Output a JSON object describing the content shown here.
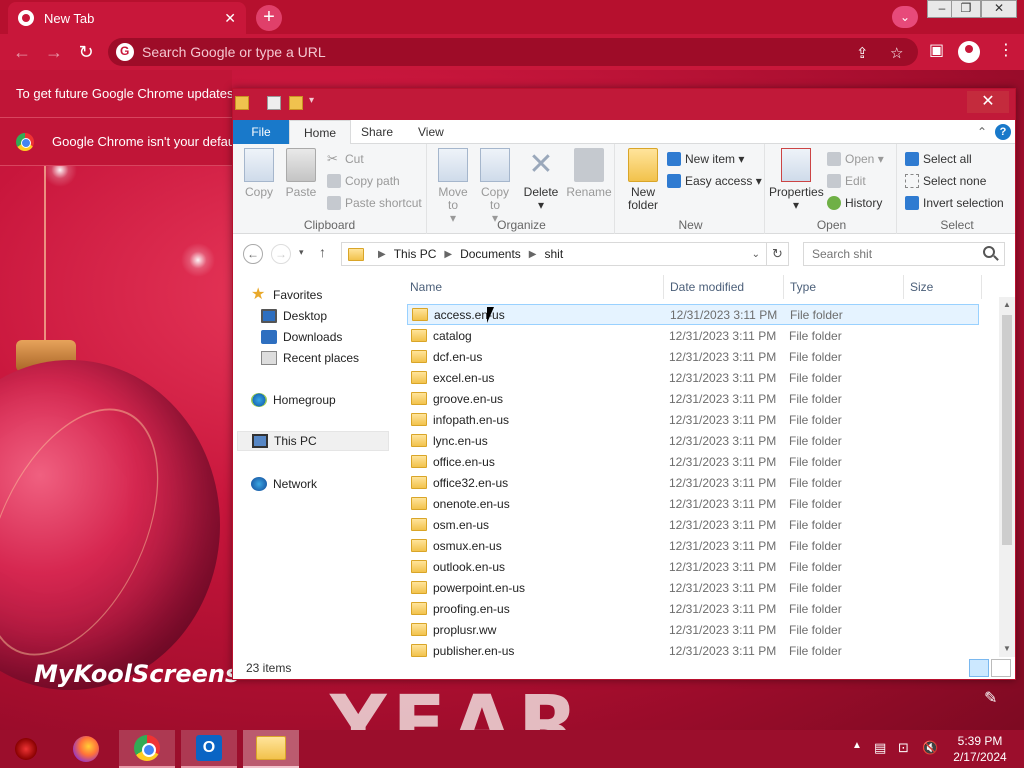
{
  "chrome": {
    "tab_title": "New Tab",
    "new_tab_symbol": "+",
    "omnibox_placeholder": "Search Google or type a URL",
    "infobar_update": "To get future Google Chrome updates",
    "infobar_default": "Google Chrome isn't your default browser"
  },
  "explorer": {
    "ribbon_tabs": [
      "File",
      "Home",
      "Share",
      "View"
    ],
    "clipboard": {
      "label": "Clipboard",
      "copy": "Copy",
      "paste": "Paste",
      "cut": "Cut",
      "copy_path": "Copy path",
      "paste_shortcut": "Paste shortcut"
    },
    "organize": {
      "label": "Organize",
      "move_to": "Move to",
      "copy_to": "Copy to",
      "delete": "Delete",
      "rename": "Rename"
    },
    "new": {
      "label": "New",
      "new_folder": "New folder",
      "new_item": "New item",
      "easy_access": "Easy access"
    },
    "open": {
      "label": "Open",
      "properties": "Properties",
      "open": "Open",
      "edit": "Edit",
      "history": "History"
    },
    "select": {
      "label": "Select",
      "select_all": "Select all",
      "select_none": "Select none",
      "invert_selection": "Invert selection"
    },
    "breadcrumb": [
      "This PC",
      "Documents",
      "shit"
    ],
    "search_placeholder": "Search shit",
    "nav": {
      "favorites": "Favorites",
      "desktop": "Desktop",
      "downloads": "Downloads",
      "recent_places": "Recent places",
      "homegroup": "Homegroup",
      "this_pc": "This PC",
      "network": "Network"
    },
    "columns": {
      "name": "Name",
      "date_modified": "Date modified",
      "type": "Type",
      "size": "Size"
    },
    "files": [
      {
        "name": "access.en-us",
        "date": "12/31/2023 3:11 PM",
        "type": "File folder"
      },
      {
        "name": "catalog",
        "date": "12/31/2023 3:11 PM",
        "type": "File folder"
      },
      {
        "name": "dcf.en-us",
        "date": "12/31/2023 3:11 PM",
        "type": "File folder"
      },
      {
        "name": "excel.en-us",
        "date": "12/31/2023 3:11 PM",
        "type": "File folder"
      },
      {
        "name": "groove.en-us",
        "date": "12/31/2023 3:11 PM",
        "type": "File folder"
      },
      {
        "name": "infopath.en-us",
        "date": "12/31/2023 3:11 PM",
        "type": "File folder"
      },
      {
        "name": "lync.en-us",
        "date": "12/31/2023 3:11 PM",
        "type": "File folder"
      },
      {
        "name": "office.en-us",
        "date": "12/31/2023 3:11 PM",
        "type": "File folder"
      },
      {
        "name": "office32.en-us",
        "date": "12/31/2023 3:11 PM",
        "type": "File folder"
      },
      {
        "name": "onenote.en-us",
        "date": "12/31/2023 3:11 PM",
        "type": "File folder"
      },
      {
        "name": "osm.en-us",
        "date": "12/31/2023 3:11 PM",
        "type": "File folder"
      },
      {
        "name": "osmux.en-us",
        "date": "12/31/2023 3:11 PM",
        "type": "File folder"
      },
      {
        "name": "outlook.en-us",
        "date": "12/31/2023 3:11 PM",
        "type": "File folder"
      },
      {
        "name": "powerpoint.en-us",
        "date": "12/31/2023 3:11 PM",
        "type": "File folder"
      },
      {
        "name": "proofing.en-us",
        "date": "12/31/2023 3:11 PM",
        "type": "File folder"
      },
      {
        "name": "proplusr.ww",
        "date": "12/31/2023 3:11 PM",
        "type": "File folder"
      },
      {
        "name": "publisher.en-us",
        "date": "12/31/2023 3:11 PM",
        "type": "File folder"
      }
    ],
    "status_items": "23 items"
  },
  "desktop": {
    "watermark": "MyKoolScreens",
    "year_text": "YEAR"
  },
  "taskbar": {
    "time": "5:39 PM",
    "date": "2/17/2024"
  },
  "colors": {
    "accent_red": "#c8173a",
    "file_tab_blue": "#1979ca",
    "selection_blue": "#e5f3ff"
  }
}
